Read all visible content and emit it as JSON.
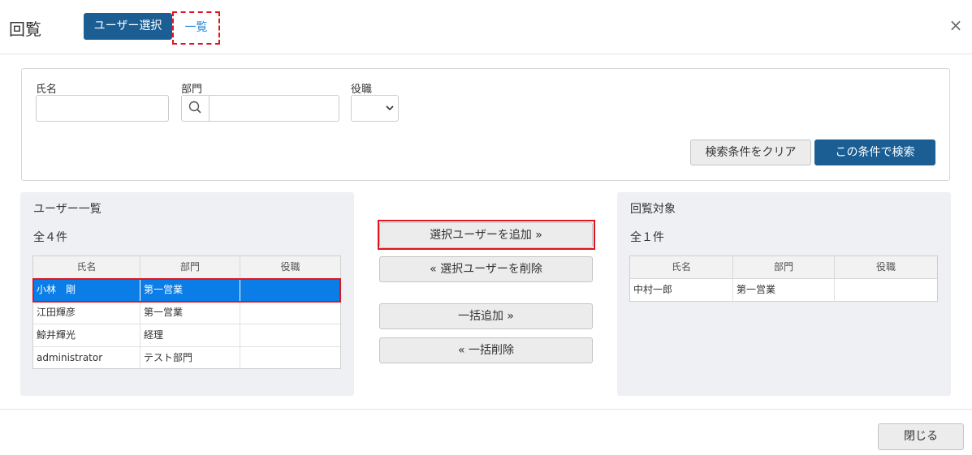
{
  "header": {
    "title": "回覧",
    "tabs": [
      {
        "label": "ユーザー選択",
        "active": true
      },
      {
        "label": "一覧",
        "active": false
      }
    ],
    "close_icon": "×"
  },
  "search": {
    "name_label": "氏名",
    "name_value": "",
    "dept_label": "部門",
    "dept_value": "",
    "role_label": "役職",
    "role_value": "",
    "clear_label": "検索条件をクリア",
    "search_label": "この条件で検索"
  },
  "user_list": {
    "title": "ユーザー一覧",
    "count": "全４件",
    "columns": [
      "氏名",
      "部門",
      "役職"
    ],
    "rows": [
      {
        "name": "小林　剛",
        "dept": "第一営業",
        "role": "",
        "selected": true
      },
      {
        "name": "江田輝彦",
        "dept": "第一営業",
        "role": "",
        "selected": false
      },
      {
        "name": "鯨井輝光",
        "dept": "経理",
        "role": "",
        "selected": false
      },
      {
        "name": "administrator",
        "dept": "テスト部門",
        "role": "",
        "selected": false
      }
    ]
  },
  "actions": {
    "add_selected": "選択ユーザーを追加 »",
    "remove_selected": "« 選択ユーザーを削除",
    "add_all": "一括追加 »",
    "remove_all": "« 一括削除"
  },
  "target_list": {
    "title": "回覧対象",
    "count": "全１件",
    "columns": [
      "氏名",
      "部門",
      "役職"
    ],
    "rows": [
      {
        "name": "中村一郎",
        "dept": "第一営業",
        "role": ""
      }
    ]
  },
  "footer": {
    "close_label": "閉じる"
  },
  "colors": {
    "accent": "#1a5e94",
    "selected_row": "#0b7de6",
    "highlight": "#e0141e",
    "link": "#2389d8"
  }
}
